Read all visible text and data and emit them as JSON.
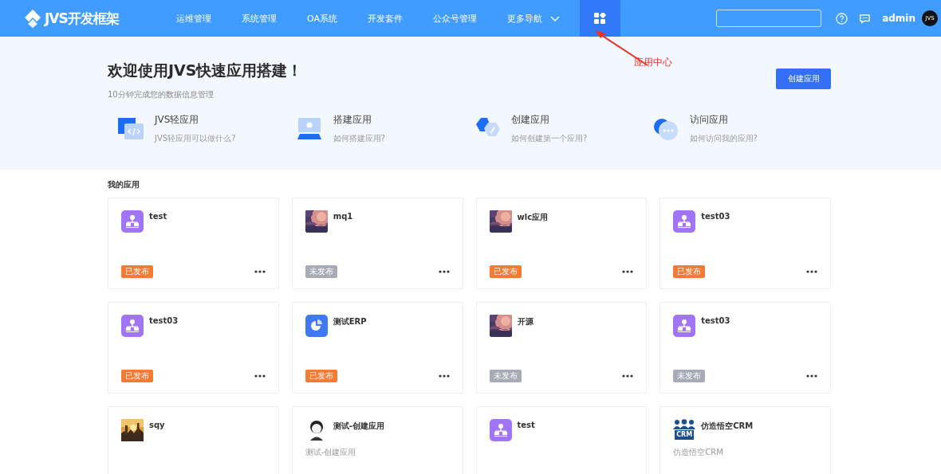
{
  "header": {
    "logo": "JVS开发框架",
    "nav": [
      {
        "label": "运维管理",
        "kind": "link"
      },
      {
        "label": "系统管理",
        "kind": "link"
      },
      {
        "label": "OA系统",
        "kind": "link"
      },
      {
        "label": "开发套件",
        "kind": "link"
      },
      {
        "label": "公众号管理",
        "kind": "link"
      },
      {
        "label": "更多导航",
        "kind": "dropdown"
      }
    ],
    "app_center_selected": true,
    "user": "admin",
    "avatar_text": "JVS"
  },
  "annotation": {
    "text": "应用中心"
  },
  "hero": {
    "title": "欢迎使用JVS快速应用搭建！",
    "subtitle": "10分钟完成您的数据信息管理",
    "button": "创建应用",
    "features": [
      {
        "kind": "code",
        "title": "JVS轻应用",
        "desc": "JVS轻应用可以做什么?"
      },
      {
        "kind": "screen",
        "title": "搭建应用",
        "desc": "如何搭建应用?"
      },
      {
        "kind": "hex",
        "title": "创建应用",
        "desc": "如何创建第一个应用?"
      },
      {
        "kind": "chat",
        "title": "访问应用",
        "desc": "如何访问我的应用?"
      }
    ]
  },
  "apps_section": {
    "title": "我的应用",
    "apps": [
      {
        "name": "test",
        "kind": "org",
        "status": "已发布",
        "published": true
      },
      {
        "name": "mq1",
        "status": "未发布",
        "published": false
      },
      {
        "name": "wlc应用",
        "status": "已发布",
        "published": true
      },
      {
        "name": "test03",
        "kind": "org",
        "status": "已发布",
        "published": true
      },
      {
        "name": "test03",
        "kind": "org",
        "status": "已发布",
        "published": true
      },
      {
        "name": "测试ERP",
        "kind": "pie",
        "status": "已发布",
        "published": true
      },
      {
        "name": "开源",
        "status": "未发布",
        "published": false
      },
      {
        "name": "test03",
        "kind": "org",
        "status": "未发布",
        "published": false
      },
      {
        "name": "sqy",
        "kind": "sunset"
      },
      {
        "name": "测试-创建应用",
        "kind": "figure",
        "description": "测试-创建应用"
      },
      {
        "name": "test",
        "kind": "org"
      },
      {
        "name": "仿造悟空CRM",
        "kind": "crm",
        "icon_text": "CRM",
        "description": "仿造悟空CRM"
      }
    ]
  }
}
